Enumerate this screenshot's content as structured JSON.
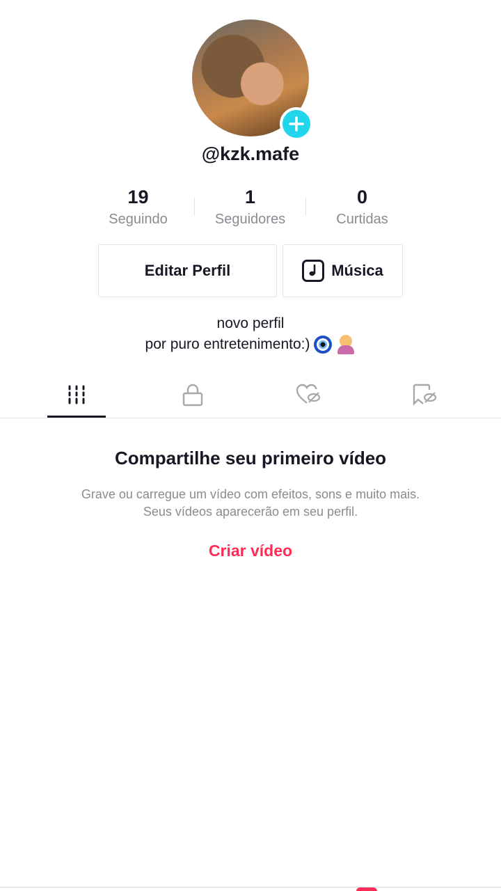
{
  "profile": {
    "username": "@kzk.mafe",
    "stats": [
      {
        "value": "19",
        "label": "Seguindo"
      },
      {
        "value": "1",
        "label": "Seguidores"
      },
      {
        "value": "0",
        "label": "Curtidas"
      }
    ],
    "edit_button": "Editar Perfil",
    "music_button": "Música",
    "bio_line1": "novo perfil",
    "bio_line2": "por puro entretenimento:)"
  },
  "tabs": [
    {
      "icon": "grid-icon",
      "active": true
    },
    {
      "icon": "lock-icon",
      "active": false
    },
    {
      "icon": "heart-hidden-icon",
      "active": false
    },
    {
      "icon": "bookmark-hidden-icon",
      "active": false
    }
  ],
  "empty_state": {
    "title": "Compartilhe seu primeiro vídeo",
    "line1": "Grave ou carregue um vídeo com efeitos, sons e muito mais.",
    "line2": "Seus vídeos aparecerão em seu perfil.",
    "cta": "Criar vídeo"
  },
  "colors": {
    "accent": "#fe2c55",
    "badge": "#20d5ec",
    "text": "#161823",
    "muted": "#8a8b91"
  }
}
